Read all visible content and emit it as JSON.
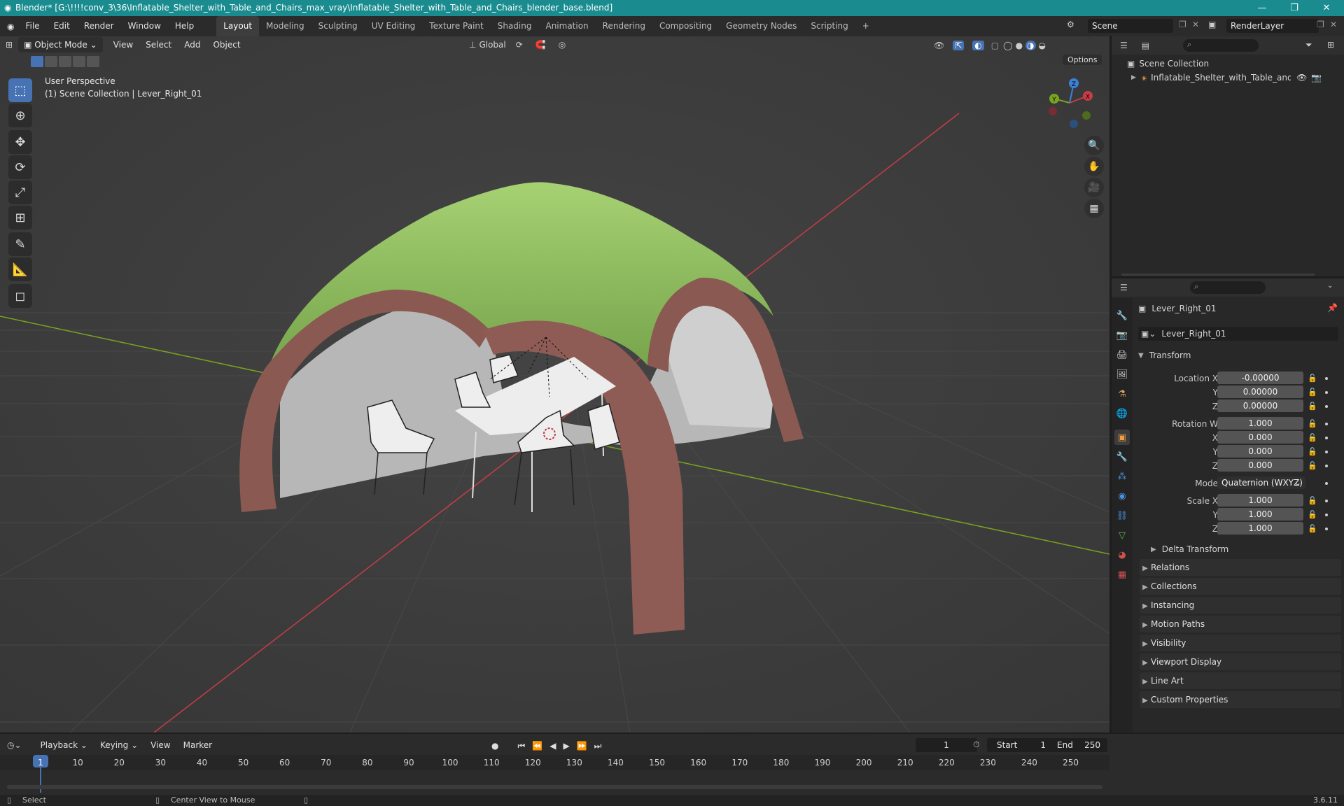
{
  "title_bar": {
    "text": "Blender* [G:\\!!!!conv_3\\36\\Inflatable_Shelter_with_Table_and_Chairs_max_vray\\Inflatable_Shelter_with_Table_and_Chairs_blender_base.blend]"
  },
  "menu": {
    "items": [
      "File",
      "Edit",
      "Render",
      "Window",
      "Help"
    ]
  },
  "workspaces": [
    "Layout",
    "Modeling",
    "Sculpting",
    "UV Editing",
    "Texture Paint",
    "Shading",
    "Animation",
    "Rendering",
    "Compositing",
    "Geometry Nodes",
    "Scripting"
  ],
  "scene": {
    "name": "Scene",
    "render_layer": "RenderLayer"
  },
  "viewport": {
    "mode": "Object Mode",
    "menus": [
      "View",
      "Select",
      "Add",
      "Object"
    ],
    "transform_orientation": "Global",
    "options_label": "Options",
    "overlay_title": "User Perspective",
    "overlay_subtitle": "(1) Scene Collection | Lever_Right_01",
    "gizmo_axes": {
      "x": "X",
      "y": "Y",
      "z": "Z"
    }
  },
  "outliner": {
    "root": "Scene Collection",
    "items": [
      {
        "label": "Inflatable_Shelter_with_Table_and_Chair"
      }
    ]
  },
  "properties": {
    "object_name": "Lever_Right_01",
    "data_name": "Lever_Right_01",
    "transform_label": "Transform",
    "location": {
      "label": "Location X",
      "x": "-0.00000",
      "y": "0.00000",
      "z": "0.00000"
    },
    "rotation": {
      "label": "Rotation W",
      "w": "1.000",
      "x": "0.000",
      "y": "0.000",
      "z": "0.000"
    },
    "mode": {
      "label": "Mode",
      "value": "Quaternion (WXYZ)"
    },
    "scale": {
      "label": "Scale X",
      "x": "1.000",
      "y": "1.000",
      "z": "1.000"
    },
    "axis_labels": {
      "x": "X",
      "y": "Y",
      "z": "Z"
    },
    "delta_transform": "Delta Transform",
    "panels": [
      "Relations",
      "Collections",
      "Instancing",
      "Motion Paths",
      "Visibility",
      "Viewport Display",
      "Line Art",
      "Custom Properties"
    ]
  },
  "timeline": {
    "menus": [
      "Playback",
      "Keying",
      "View",
      "Marker"
    ],
    "current_frame": "1",
    "start_label": "Start",
    "start": "1",
    "end_label": "End",
    "end": "250",
    "ruler": [
      "1",
      "10",
      "20",
      "30",
      "40",
      "50",
      "60",
      "70",
      "80",
      "90",
      "100",
      "110",
      "120",
      "130",
      "140",
      "150",
      "160",
      "170",
      "180",
      "190",
      "200",
      "210",
      "220",
      "230",
      "240",
      "250"
    ]
  },
  "status_bar": {
    "select": "Select",
    "center_view": "Center View to Mouse",
    "version": "3.6.11"
  },
  "colors": {
    "accent": "#4772b3",
    "title_bar": "#1a8c8f",
    "x_axis": "#c83c46",
    "y_axis": "#7aa31f",
    "z_axis": "#3b82d8"
  }
}
